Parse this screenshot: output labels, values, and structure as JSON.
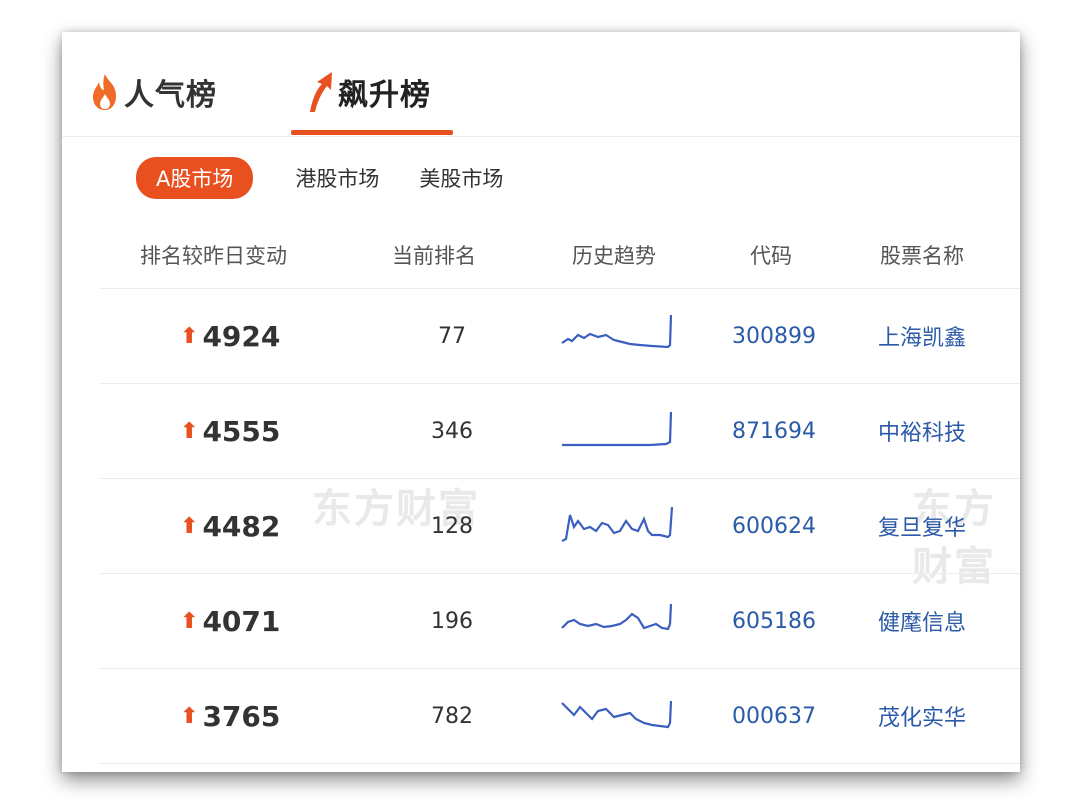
{
  "tabs": [
    {
      "label": "人气榜",
      "icon": "flame-icon"
    },
    {
      "label": "飙升榜",
      "icon": "rising-arrow-icon"
    }
  ],
  "active_tab": 1,
  "accent_color": "#e8501f",
  "link_color": "#2b5aa8",
  "markets": [
    "A股市场",
    "港股市场",
    "美股市场"
  ],
  "active_market": 0,
  "table": {
    "headers": [
      "排名较昨日变动",
      "当前排名",
      "历史趋势",
      "代码",
      "股票名称"
    ],
    "rows": [
      {
        "change": "4924",
        "rank": "77",
        "code": "300899",
        "name": "上海凯鑫"
      },
      {
        "change": "4555",
        "rank": "346",
        "code": "871694",
        "name": "中裕科技"
      },
      {
        "change": "4482",
        "rank": "128",
        "code": "600624",
        "name": "复旦复华"
      },
      {
        "change": "4071",
        "rank": "196",
        "code": "605186",
        "name": "健麾信息"
      },
      {
        "change": "3765",
        "rank": "782",
        "code": "000637",
        "name": "茂化实华"
      }
    ]
  },
  "watermark": "东方财富"
}
